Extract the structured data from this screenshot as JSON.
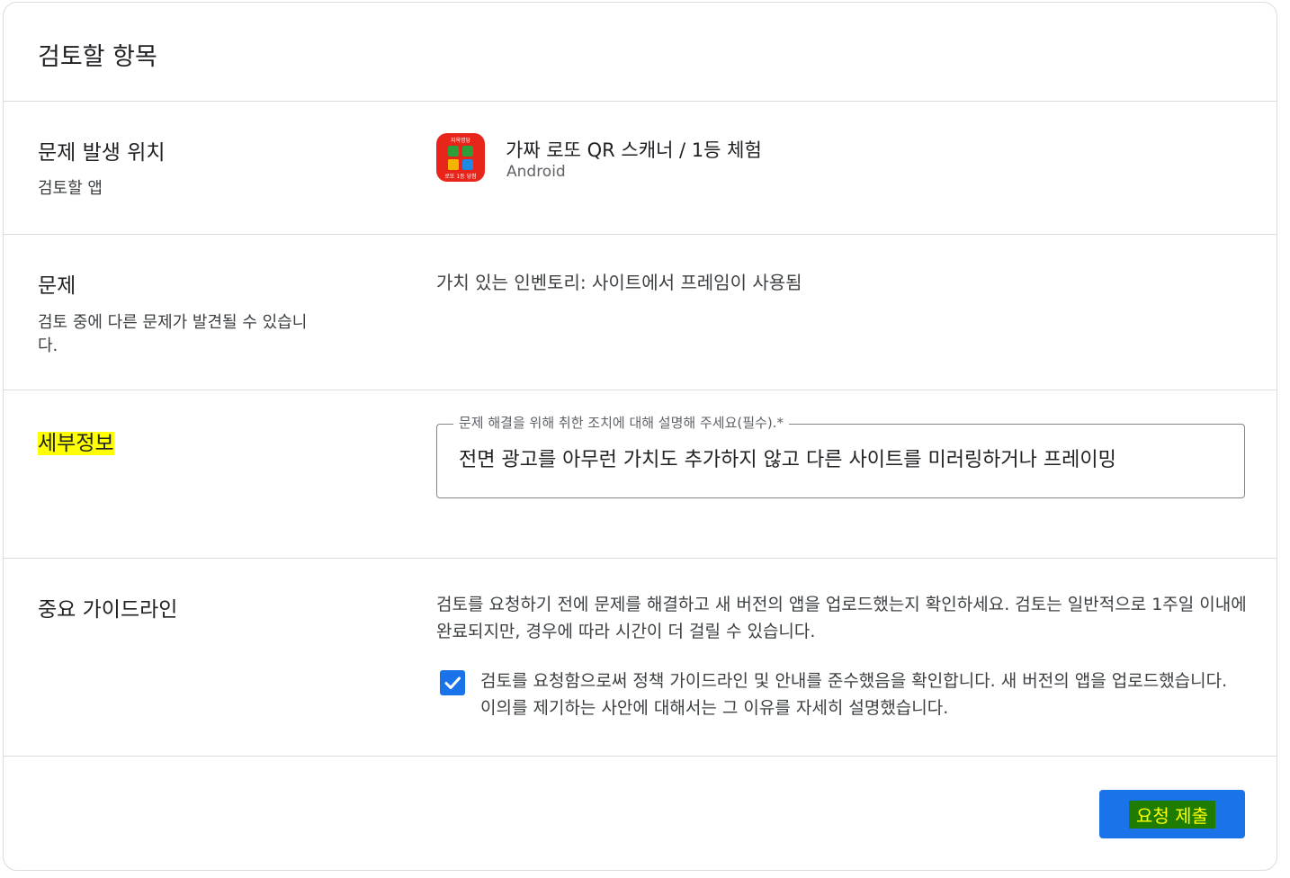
{
  "header": {
    "title": "검토할 항목"
  },
  "location": {
    "label": "문제 발생 위치",
    "sub": "검토할 앱",
    "app": {
      "icon_top_text": "지옥명당",
      "icon_bottom_text": "로또 1등 당첨",
      "name": "가짜 로또 QR 스캐너 / 1등 체험",
      "platform": "Android"
    }
  },
  "issue": {
    "label": "문제",
    "sub": "검토 중에 다른 문제가 발견될 수 있습니다.",
    "value": "가치 있는 인벤토리: 사이트에서 프레임이 사용됨"
  },
  "details": {
    "label": "세부정보",
    "field_label": "문제 해결을 위해 취한 조치에 대해 설명해 주세요(필수).*",
    "field_value": "전면 광고를 아무런 가치도 추가하지 않고 다른 사이트를 미러링하거나 프레이밍"
  },
  "guidelines": {
    "label": "중요 가이드라인",
    "text": "검토를 요청하기 전에 문제를 해결하고 새 버전의 앱을 업로드했는지 확인하세요. 검토는 일반적으로 1주일 이내에 완료되지만, 경우에 따라 시간이 더 걸릴 수 있습니다.",
    "checkbox_checked": true,
    "checkbox_text": "검토를 요청함으로써 정책 가이드라인 및 안내를 준수했음을 확인합니다. 새 버전의 앱을 업로드했습니다. 이의를 제기하는 사안에 대해서는 그 이유를 자세히 설명했습니다."
  },
  "submit": {
    "label": "요청 제출"
  },
  "colors": {
    "accent": "#1a73e8",
    "highlight": "#ffff00",
    "button_highlight": "#1e7d00",
    "icon_bg": "#e8251a"
  },
  "icons": {
    "checkbox": "check-icon",
    "app": "lotto-app-icon"
  }
}
